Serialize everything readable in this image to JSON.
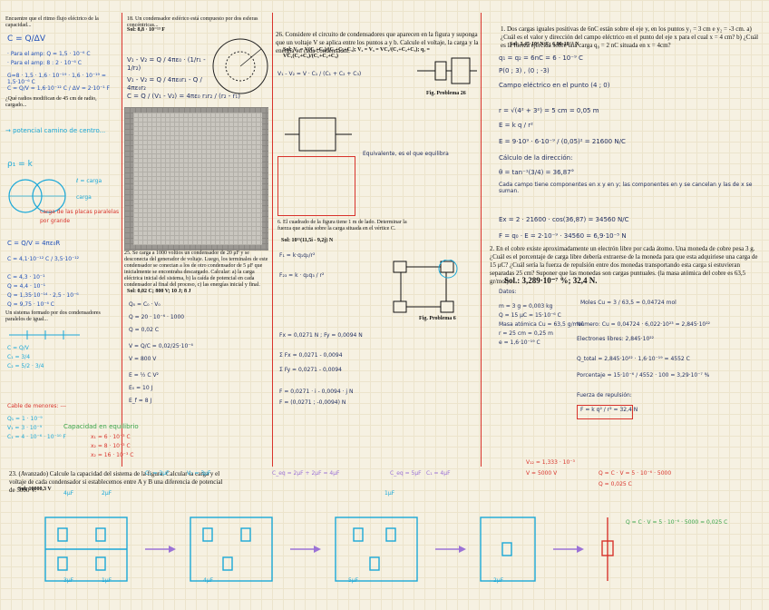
{
  "col1": {
    "intro": "Encuentre que el ritmo flujo eléctrico de la capacidad...",
    "C": "C = Q/ΔV",
    "lines": [
      "· Para el amp: Q = 1,5 · 10⁻⁶ C",
      "· Para el amp: 8 : 2 · 10⁻⁶ C",
      "G=8 · 1,5 · 1,6 · 10⁻¹⁹ · 1,6 · 10⁻¹⁹ = 1,5·10⁻⁶ C",
      "C = Q/V = 1,6·10⁻¹² C / ΔV = 2·10⁻¹ F"
    ],
    "q2": "¿Qué radios modifican de 45 cm de radio, cargado...",
    "potencial": "→ potencial camino de centro...",
    "rho": "ρ₁ = k",
    "notes": [
      "ℓ = carga",
      "carga",
      "carga de las placas paralelas",
      "por grande"
    ],
    "eq2": "C = Q/V = 4πε₀R",
    "dimensions": "C = 4,1·10⁻¹² C / 3,5·10⁻¹²",
    "n1": "C = 4,3 · 10⁻¹",
    "n2": "Q = 4,4 · 10⁻¹",
    "n3": "Q = 1,35·10⁻¹⁴ · 2,5 · 10⁻⁶",
    "n4": "Q = 9,75 · 10⁻⁶ C",
    "q3": "Un sistema formado por dos condensadores paralelos de igual...",
    "cap_lines": [
      "C = Q/V",
      "C₁ = 3/4",
      "C₂ = 5/2 · 3/4"
    ],
    "cables": "Cable de menores: ---",
    "cable_lines": [
      "Q₁ = 1 · 10⁻⁹",
      "V₁ = 3 · 10⁻⁹",
      "C₁ = 4 · 10⁻⁶ · 10⁻¹⁰ F"
    ],
    "green": "Capacidad en equilibrio",
    "red1": [
      "x₁ = 6 · 10⁻³ C",
      "x₂ = 8 · 10⁻³ C",
      "x₂ = 16 · 10⁻³ C"
    ]
  },
  "col2": {
    "q": "18. Un condensador esférico está compuesto por dos esferas concéntricas...",
    "sol": "Sol: 8,8 · 10⁻¹³ F",
    "eq1": "V₁ - V₂ = Q / 4πε₀ · (1/r₁ - 1/r₂)",
    "eq2": "V₁ - V₂ = Q / 4πε₀r₁ - Q / 4πε₀r₂",
    "eq3": "C = Q / (V₁ - V₂) = 4πε₀ r₁r₂ / (r₂ - r₁)",
    "q19": "19. Un condensador de 20 μF se conecta a una batería...",
    "q25": "25. Se carga a 1000 voltios un condensador de 20 μF y se desconecta del generador de voltaje. Luego, los terminales de este condensador se conectan a los de otro condensador de 5 μF que inicialmente se encontraba descargado. Calcular: a) la carga eléctrica inicial del sistema, b) la caída de potencial en cada condensador al final del proceso, c) las energías inicial y final.",
    "sol25": "Sol: 0,02 C; 800 V; 10 J; 8 J",
    "work": [
      "Q₀ = C₀ · V₀",
      "Q = 20 · 10⁻⁶ · 1000",
      "Q = 0,02 C",
      "V = Q/C = 0,02/25·10⁻⁶",
      "V = 800 V",
      "E = ½ C V²",
      "E₀ = 10 J",
      "E_f = 8 J"
    ]
  },
  "col3": {
    "q26": "26. Considere el circuito de condensadores que aparecen en la figura y suponga que un voltaje V se aplica entre los puntos a y b. Calcule el voltaje, la carga y la energía en cada condensador.",
    "sol26": "Sol: V₁ = V(C₂+C₃)/(C₁+C₂+C₃); V₂ = V₃ = VC₁/(C₁+C₂+C₃); q₁ = VC₁(C₂+C₃)/(C₁+C₂+C₃)",
    "fig": "Fig. Problema 26",
    "eq": "V₁ - V₂ = V · C₁ / (C₁ + C₂ + C₃)",
    "note": "Equivalente, es el que equilibra",
    "q6": "6. El cuadrado de la figura tiene 1 m de lado. Determinar la fuerza que actúa sobre la carga situada en el vértice C.",
    "sol6": "Sol: 10¹¹(11,5i - 9,2j) N",
    "fig6": "Fig. Problema 6",
    "work": [
      "F₁ = k·q₁q₂/r²",
      "F₂₃ = k · q₂q₃ / r²",
      "Fx = 0,0271 N ; Fy = 0,0094 N",
      "Σ Fx = 0,0271 - 0,0094",
      "Σ Fy = 0,0271 - 0,0094",
      "F = 0,0271 · i - 0,0094 · j N",
      "F = (0,0271 ; -0,0094) N"
    ]
  },
  "col4": {
    "q1": "1. Dos cargas iguales positivas de 6nC están sobre el eje y, en los puntos y₁ = 3 cm e y₂ = -3 cm. a) ¿Cuál es el valor y dirección del campo eléctrico en el punto del eje x para el cual x = 4 cm? b) ¿Cuál es la fuerza ejercida sobre una carga q₀ = 2 nC situada en x = 4cm?",
    "sol1": "Sol: 3,45·10⁴ N/C; 6,90·10⁻⁵ N",
    "work": [
      "q₁ = q₂ = 6nC = 6 · 10⁻⁹ C",
      "P(0 ; 3) , (0 ; -3)",
      "Campo eléctrico en el punto (4 ; 0)",
      "r = √(4² + 3²) = 5 cm = 0,05 m",
      "E = k q / r²",
      "E = 9·10⁹ · 6·10⁻⁹ / (0,05)² = 21600 N/C",
      "Cálculo de la dirección:",
      "θ = tan⁻¹(3/4) = 36,87°",
      "Cada campo tiene componentes en x y en y; las componentes en y se cancelan y las de x se suman.",
      "Ex = 2 · 21600 · cos(36,87) = 34560 N/C",
      "F = q₀ · E = 2·10⁻⁹ · 34560 = 6,9·10⁻⁵ N"
    ],
    "q2": "2. En el cobre existe aproximadamente un electrón libre por cada átomo. Una moneda de cobre pesa 3 g. ¿Cuál es el porcentaje de carga libre debería extraerse de la moneda para que esta adquiriese una carga de 15 μC? ¿Cuál sería la fuerza de repulsión entre dos monedas transportando esta carga si estuvieran separadas 25 cm? Suponer que las monedas son cargas puntuales. (la masa atómica del cobre es 63,5 gr/mol)",
    "sol2": "Sol.: 3,289·10⁻⁷ %; 32,4 N.",
    "work2": [
      "Datos:",
      "m = 3 g = 0,003 kg",
      "Q = 15 μC = 15·10⁻⁶ C",
      "Masa atómica Cu = 63,5 g/mol",
      "r = 25 cm = 0,25 m",
      "e = 1,6·10⁻¹⁹ C",
      "Moles Cu = 3 / 63,5 = 0,04724 mol",
      "Número: Cu = 0,04724 · 6,022·10²³ = 2,845·10²²",
      "Electrones libres: 2,845·10²²",
      "Q_total = 2,845·10²² · 1,6·10⁻¹⁹ = 4552 C",
      "Porcentaje = 15·10⁻⁶ / 4552 · 100 = 3,29·10⁻⁷ %",
      "Fuerza de repulsión:",
      "F = k q² / r² = 32,4 N"
    ]
  },
  "bottom": {
    "q23": "23. (Avanzado) Calcule la capacidad del sistema de la figura. Calcular la carga y el voltaje de cada condensador si establecemos entre A y B una diferencia de potencial de 5000 V.",
    "sol23": "Sol: 10000,3 V",
    "steps": [
      "C₁ = 2μF",
      "V₁ = 3μF",
      "C_eq = 2μF + 2μF = 4μF",
      "C_eq = 5μF",
      "C₁ = 4μF",
      "V₁₂ = 1,333 · 10⁻³",
      "V = 5000 V",
      "Q = C · V = 5 · 10⁻⁶ · 5000",
      "Q = 0,025 C"
    ],
    "labels": [
      "4μF",
      "2μF",
      "3μF",
      "1μF",
      "4μF",
      "5μF",
      "2μF",
      "1μF"
    ],
    "final": "Q = C · V = 5 · 10⁻⁶ · 5000 = 0,025 C"
  },
  "colors": {
    "blue": "#1f4fb8",
    "cyan": "#1aa8d8",
    "red": "#d8332b",
    "green": "#3aa54a",
    "violet": "#9b72d6"
  }
}
